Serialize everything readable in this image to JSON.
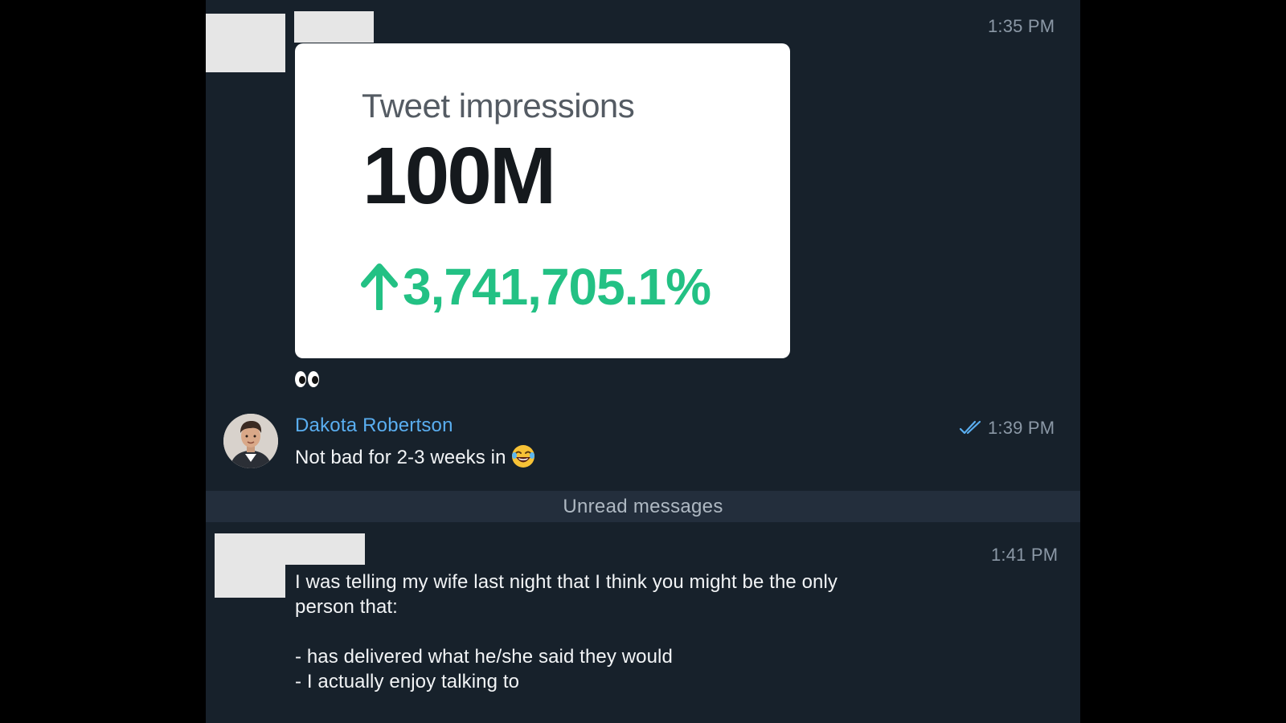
{
  "messages": [
    {
      "time": "1:35 PM",
      "image": {
        "title": "Tweet impressions",
        "value": "100M",
        "change": "3,741,705.1%",
        "change_color": "#23c184"
      },
      "caption_icon": "eyes-emoji-icon"
    },
    {
      "sender": "Dakota Robertson",
      "time": "1:39 PM",
      "text": "Not bad for 2-3 weeks in",
      "emoji_icon": "face-with-tears-of-joy-icon",
      "read_status_icon": "double-check-icon"
    },
    {
      "time": "1:41 PM",
      "lines": [
        "I was telling my wife last night that I think you might be the only",
        "person that:",
        "",
        "- has delivered what he/she said they would",
        "- I actually enjoy talking to"
      ]
    }
  ],
  "unread_divider": "Unread messages",
  "colors": {
    "chat_background": "#17212b",
    "sender_name": "#5aaef0",
    "timestamp": "#8b98a6",
    "unread_bar": "#232e3c",
    "outer_background": "#000000"
  }
}
